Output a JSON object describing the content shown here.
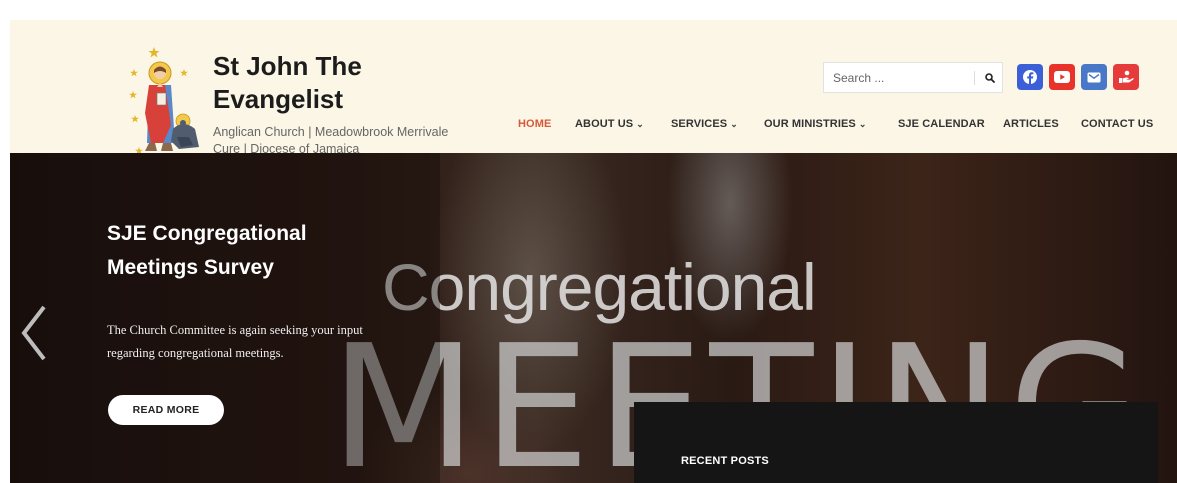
{
  "site": {
    "title": "St John The Evangelist",
    "tagline": "Anglican Church | Meadowbrook Merrivale Cure | Diocese of Jamaica"
  },
  "search": {
    "placeholder": "Search ...",
    "icon": "search-icon"
  },
  "social": [
    {
      "icon": "facebook-icon",
      "color": "#3b5fd6"
    },
    {
      "icon": "youtube-icon",
      "color": "#e8322a"
    },
    {
      "icon": "email-icon",
      "color": "#4a78c9"
    },
    {
      "icon": "donate-icon",
      "color": "#e53b3b"
    }
  ],
  "nav": {
    "home": "HOME",
    "about": "ABOUT US",
    "services": "SERVICES",
    "ministries": "OUR MINISTRIES",
    "calendar": "SJE CALENDAR",
    "articles": "ARTICLES",
    "contact": "CONTACT US",
    "active_color": "#d55a3a"
  },
  "hero": {
    "background_word1": "Congregational",
    "background_word2": "MEETING",
    "slide_title": "SJE Congregational Meetings Survey",
    "slide_text": "The Church Committee is again seeking your input regarding congregational meetings.",
    "button": "READ MORE"
  },
  "sidebar": {
    "recent_posts_title": "RECENT POSTS"
  }
}
